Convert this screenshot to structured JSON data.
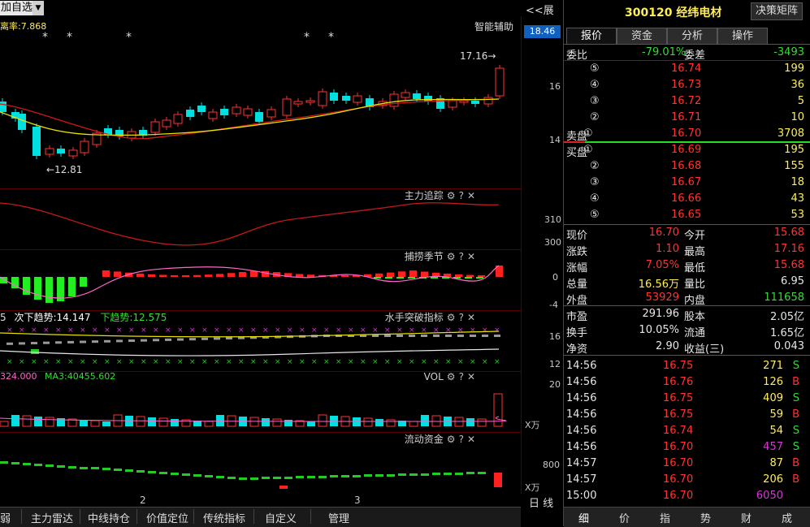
{
  "toolbar": {
    "add_label": "加自选",
    "expand_label": "<<展开",
    "assist_label": "智能辅助"
  },
  "main": {
    "indicator_text": "离率:7.868",
    "price_high_label": "18.46",
    "tick_16": "16",
    "tick_14": "14",
    "max_note": "17.16→",
    "min_note": "←12.81"
  },
  "panels": {
    "zhuli": {
      "title": "主力追踪",
      "tick_a": "310",
      "tick_b": "300"
    },
    "buzhuo": {
      "title": "捕捞季节",
      "tick_a": "0",
      "tick_b": "-4"
    },
    "shuishou": {
      "title": "水手突破指标",
      "leg_a": "5",
      "leg_b": "次下趋势:14.147",
      "leg_c": "下趋势:12.575",
      "tick_a": "16",
      "tick_b": "12"
    },
    "vol": {
      "title": "VOL",
      "leg_a": "324.000",
      "leg_b": "MA3:40455.602",
      "tick_a": "20",
      "unit": "X万"
    },
    "liudong": {
      "title": "流动资金",
      "tick_a": "800",
      "unit": "X万"
    }
  },
  "x_axis": {
    "label_a": "2",
    "label_b": "3",
    "day_label": "日 线"
  },
  "bottom_tabs": [
    "弱",
    "主力雷达",
    "中线持仓",
    "价值定位",
    "传统指标",
    "自定义",
    "管理"
  ],
  "quote": {
    "code_name": "300120 经纬电材",
    "decision_button": "决策矩阵",
    "tabs": [
      "报价",
      "资金",
      "分析",
      "操作"
    ],
    "weibi_label": "委比",
    "weibi_value": "-79.01%",
    "weicha_label": "委差",
    "weicha_value": "-3493",
    "sell_label": "卖盘",
    "buy_label": "买盘",
    "asks": [
      {
        "lvl": "⑤",
        "price": "16.74",
        "vol": "199"
      },
      {
        "lvl": "④",
        "price": "16.73",
        "vol": "36"
      },
      {
        "lvl": "③",
        "price": "16.72",
        "vol": "5"
      },
      {
        "lvl": "②",
        "price": "16.71",
        "vol": "10"
      },
      {
        "lvl": "①",
        "price": "16.70",
        "vol": "3708"
      }
    ],
    "bids": [
      {
        "lvl": "①",
        "price": "16.69",
        "vol": "195"
      },
      {
        "lvl": "②",
        "price": "16.68",
        "vol": "155"
      },
      {
        "lvl": "③",
        "price": "16.67",
        "vol": "18"
      },
      {
        "lvl": "④",
        "price": "16.66",
        "vol": "43"
      },
      {
        "lvl": "⑤",
        "price": "16.65",
        "vol": "53"
      }
    ],
    "stats": [
      {
        "l1": "现价",
        "v1": "16.70",
        "l2": "今开",
        "v2": "15.68"
      },
      {
        "l1": "涨跌",
        "v1": "1.10",
        "l2": "最高",
        "v2": "17.16"
      },
      {
        "l1": "涨幅",
        "v1": "7.05%",
        "l2": "最低",
        "v2": "15.68"
      },
      {
        "l1": "总量",
        "v1": "16.56万",
        "l2": "量比",
        "v2": "6.95"
      },
      {
        "l1": "外盘",
        "v1": "53929",
        "l2": "内盘",
        "v2": "111658"
      }
    ],
    "fund": [
      {
        "l1": "市盈",
        "v1": "291.96",
        "l2": "股本",
        "v2": "2.05亿"
      },
      {
        "l1": "换手",
        "v1": "10.05%",
        "l2": "流通",
        "v2": "1.65亿"
      },
      {
        "l1": "净资",
        "v1": "2.90",
        "l2": "收益(三)",
        "v2": "0.043"
      }
    ],
    "ticks": [
      {
        "t": "14:56",
        "p": "16.75",
        "v": "271",
        "s": "S"
      },
      {
        "t": "14:56",
        "p": "16.76",
        "v": "126",
        "s": "B"
      },
      {
        "t": "14:56",
        "p": "16.75",
        "v": "409",
        "s": "S"
      },
      {
        "t": "14:56",
        "p": "16.75",
        "v": "59",
        "s": "B"
      },
      {
        "t": "14:56",
        "p": "16.74",
        "v": "54",
        "s": "S"
      },
      {
        "t": "14:56",
        "p": "16.70",
        "v": "457",
        "s": "S"
      },
      {
        "t": "14:57",
        "p": "16.70",
        "v": "87",
        "s": "B"
      },
      {
        "t": "14:57",
        "p": "16.70",
        "v": "206",
        "s": "B"
      },
      {
        "t": "15:00",
        "p": "16.70",
        "v": "6050",
        "s": ""
      }
    ],
    "bottom": [
      "细",
      "价",
      "指",
      "势",
      "财",
      "成"
    ]
  }
}
